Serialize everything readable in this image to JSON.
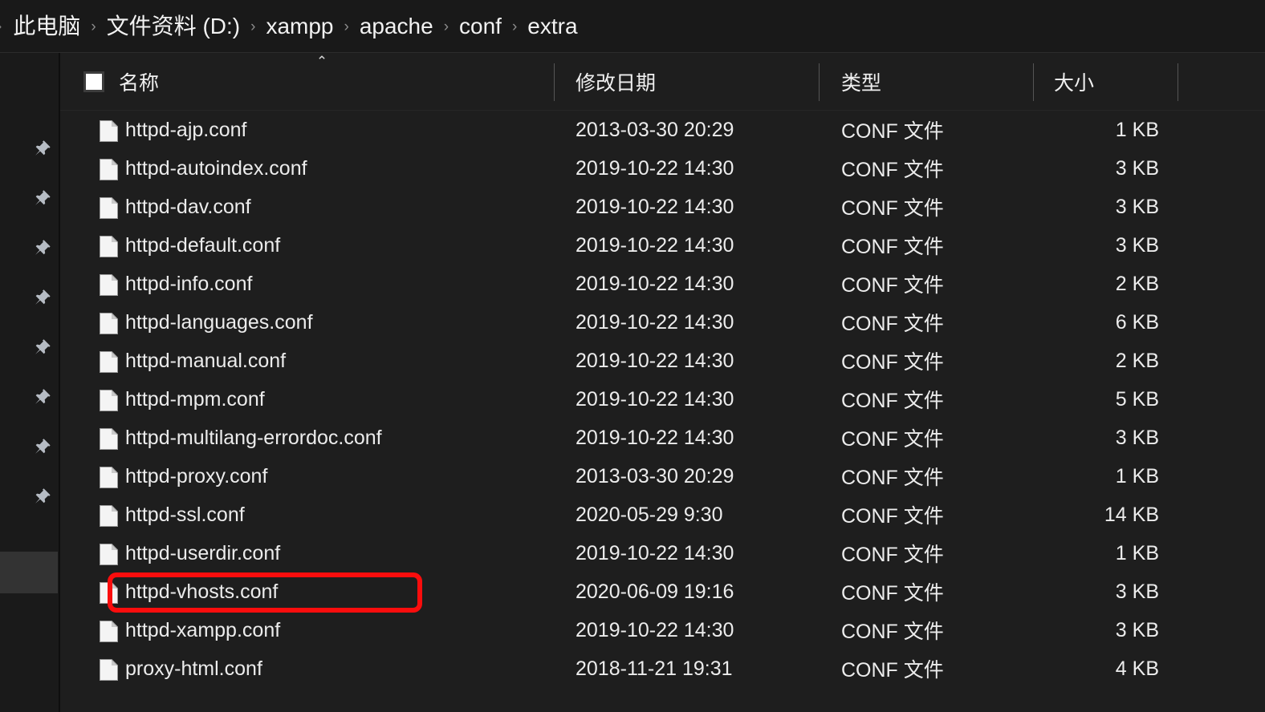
{
  "window": {
    "theme": "dark",
    "bg_color": "#1e1e1e",
    "accent_annotation_color": "#fa0d0d"
  },
  "breadcrumb": {
    "name": "address-breadcrumb",
    "leading_separator": "›",
    "separator": "›",
    "items": [
      {
        "label": "此电脑"
      },
      {
        "label": "文件资料 (D:)"
      },
      {
        "label": "xampp"
      },
      {
        "label": "apache"
      },
      {
        "label": "conf"
      },
      {
        "label": "extra"
      }
    ]
  },
  "nav_pane": {
    "pin_icon_name": "pushpin-icon",
    "pin_count": 8,
    "hovered_index": 8
  },
  "columns": {
    "sort_indicator": "⌃",
    "sorted_by": "名称",
    "sort_direction": "ascending",
    "headers": [
      {
        "label": "名称",
        "key": "name"
      },
      {
        "label": "修改日期",
        "key": "date"
      },
      {
        "label": "类型",
        "key": "type"
      },
      {
        "label": "大小",
        "key": "size"
      }
    ]
  },
  "files": [
    {
      "name": "httpd-ajp.conf",
      "date": "2013-03-30 20:29",
      "type": "CONF 文件",
      "size": "1 KB",
      "icon": "file-icon",
      "highlighted": false
    },
    {
      "name": "httpd-autoindex.conf",
      "date": "2019-10-22 14:30",
      "type": "CONF 文件",
      "size": "3 KB",
      "icon": "file-icon",
      "highlighted": false
    },
    {
      "name": "httpd-dav.conf",
      "date": "2019-10-22 14:30",
      "type": "CONF 文件",
      "size": "3 KB",
      "icon": "file-icon",
      "highlighted": false
    },
    {
      "name": "httpd-default.conf",
      "date": "2019-10-22 14:30",
      "type": "CONF 文件",
      "size": "3 KB",
      "icon": "file-icon",
      "highlighted": false
    },
    {
      "name": "httpd-info.conf",
      "date": "2019-10-22 14:30",
      "type": "CONF 文件",
      "size": "2 KB",
      "icon": "file-icon",
      "highlighted": false
    },
    {
      "name": "httpd-languages.conf",
      "date": "2019-10-22 14:30",
      "type": "CONF 文件",
      "size": "6 KB",
      "icon": "file-icon",
      "highlighted": false
    },
    {
      "name": "httpd-manual.conf",
      "date": "2019-10-22 14:30",
      "type": "CONF 文件",
      "size": "2 KB",
      "icon": "file-icon",
      "highlighted": false
    },
    {
      "name": "httpd-mpm.conf",
      "date": "2019-10-22 14:30",
      "type": "CONF 文件",
      "size": "5 KB",
      "icon": "file-icon",
      "highlighted": false
    },
    {
      "name": "httpd-multilang-errordoc.conf",
      "date": "2019-10-22 14:30",
      "type": "CONF 文件",
      "size": "3 KB",
      "icon": "file-icon",
      "highlighted": false
    },
    {
      "name": "httpd-proxy.conf",
      "date": "2013-03-30 20:29",
      "type": "CONF 文件",
      "size": "1 KB",
      "icon": "file-icon",
      "highlighted": false
    },
    {
      "name": "httpd-ssl.conf",
      "date": "2020-05-29 9:30",
      "type": "CONF 文件",
      "size": "14 KB",
      "icon": "file-icon",
      "highlighted": false
    },
    {
      "name": "httpd-userdir.conf",
      "date": "2019-10-22 14:30",
      "type": "CONF 文件",
      "size": "1 KB",
      "icon": "file-icon",
      "highlighted": false
    },
    {
      "name": "httpd-vhosts.conf",
      "date": "2020-06-09 19:16",
      "type": "CONF 文件",
      "size": "3 KB",
      "icon": "file-icon",
      "highlighted": true
    },
    {
      "name": "httpd-xampp.conf",
      "date": "2019-10-22 14:30",
      "type": "CONF 文件",
      "size": "3 KB",
      "icon": "file-icon",
      "highlighted": false
    },
    {
      "name": "proxy-html.conf",
      "date": "2018-11-21 19:31",
      "type": "CONF 文件",
      "size": "4 KB",
      "icon": "file-icon",
      "highlighted": false
    }
  ],
  "annotation": {
    "name": "red-highlight-box",
    "target_file": "httpd-vhosts.conf",
    "color": "#fa0d0d"
  }
}
